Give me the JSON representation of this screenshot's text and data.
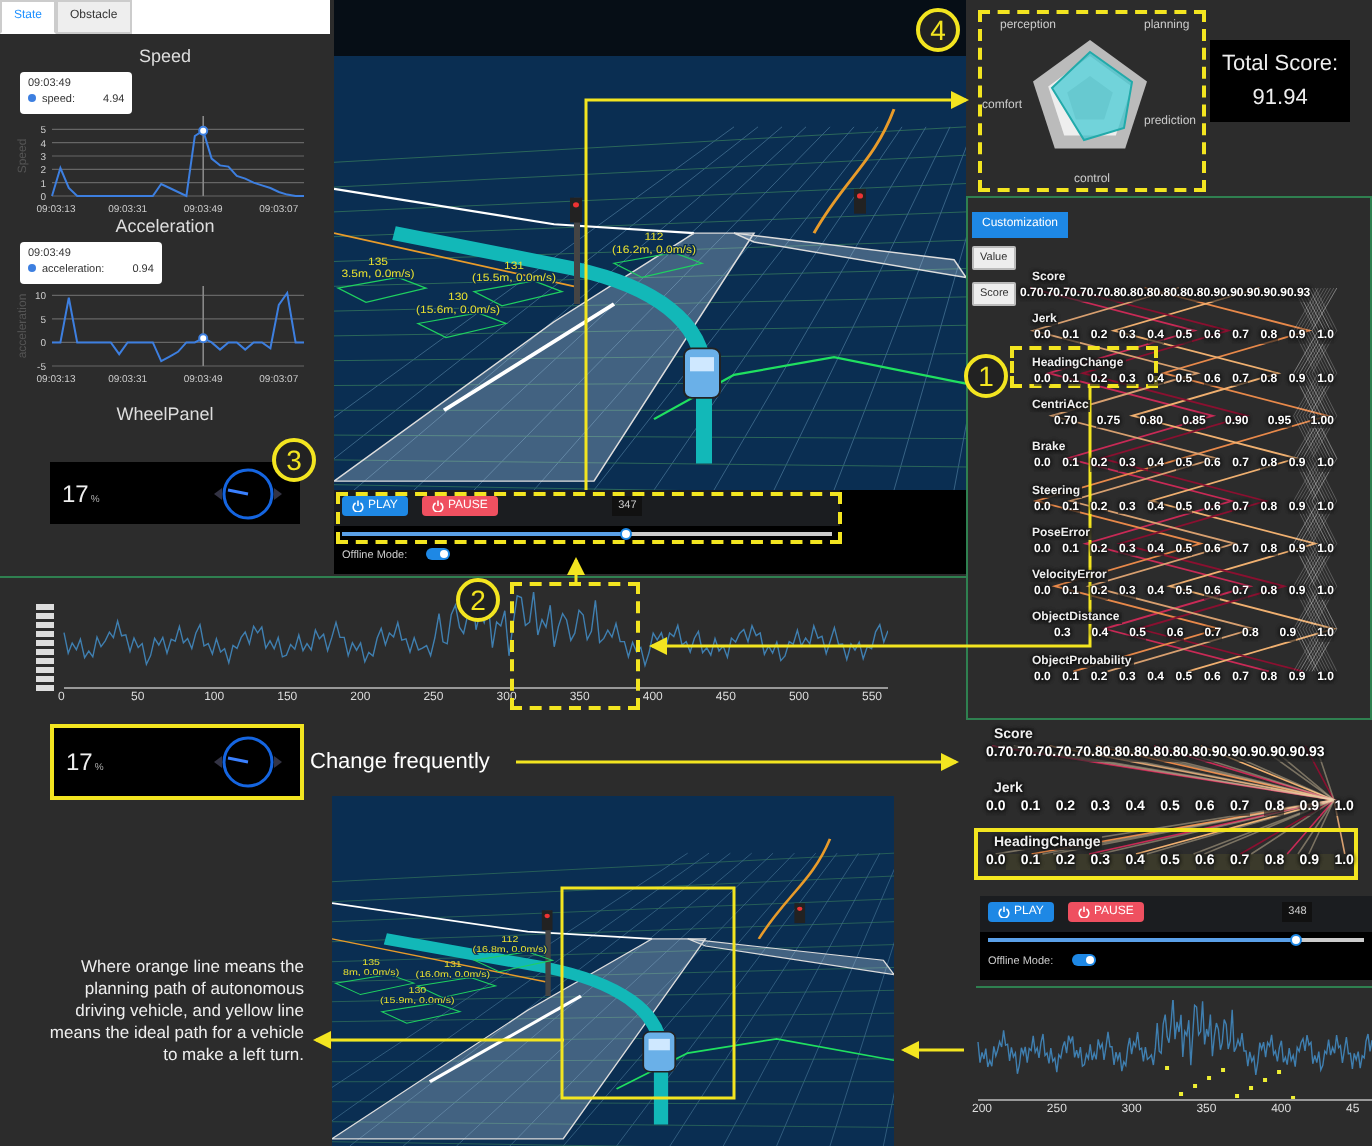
{
  "tabs": [
    {
      "label": "State",
      "selected": true
    },
    {
      "label": "Obstacle",
      "selected": false
    }
  ],
  "speed_chart": {
    "title": "Speed",
    "tooltip": {
      "time": "09:03:49",
      "series": "speed:",
      "value": "4.94"
    },
    "chart_data": {
      "type": "line",
      "ylabel": "Speed",
      "categories": [
        "09:03:13",
        null,
        null,
        null,
        null,
        null,
        null,
        null,
        null,
        "09:03:31",
        null,
        null,
        null,
        null,
        null,
        null,
        null,
        null,
        "09:03:49",
        null,
        null,
        null,
        null,
        null,
        null,
        null,
        null,
        "09:03:07",
        null,
        null,
        null
      ],
      "series": [
        {
          "color": "#3d7fe0",
          "values": [
            0,
            2.1,
            0.6,
            0,
            0,
            0,
            0,
            0,
            0,
            0,
            0,
            0,
            0,
            0.9,
            0.6,
            0.3,
            0,
            4.5,
            4.9,
            2.8,
            2.3,
            2.2,
            1.5,
            1.3,
            1.0,
            0.8,
            0.6,
            0.3,
            0.1,
            0,
            0
          ]
        }
      ],
      "yticks": [
        0,
        1,
        2,
        3,
        4,
        5
      ],
      "ylim": [
        0,
        6
      ],
      "grid": true
    }
  },
  "acceleration_chart": {
    "title": "Acceleration",
    "tooltip": {
      "time": "09:03:49",
      "series": "acceleration:",
      "value": "0.94"
    },
    "chart_data": {
      "type": "line",
      "ylabel": "acceleration",
      "categories": [
        "09:03:13",
        null,
        null,
        null,
        null,
        null,
        null,
        null,
        null,
        "09:03:31",
        null,
        null,
        null,
        null,
        null,
        null,
        null,
        null,
        "09:03:49",
        null,
        null,
        null,
        null,
        null,
        null,
        null,
        null,
        "09:03:07",
        null,
        null,
        null
      ],
      "series": [
        {
          "color": "#3d7fe0",
          "values": [
            0,
            0,
            9.5,
            0,
            0,
            0,
            0,
            0,
            -2.5,
            0,
            0,
            0,
            0,
            -4,
            -3,
            -2,
            0,
            0,
            0.9,
            0,
            -1.5,
            0,
            0,
            -1.5,
            0,
            0,
            -1.2,
            8,
            10.5,
            0,
            0
          ]
        }
      ],
      "yticks": [
        -5,
        0,
        5,
        10
      ],
      "ylim": [
        -5,
        12
      ],
      "grid": true
    }
  },
  "wheel_panel": {
    "title": "WheelPanel",
    "value": "17",
    "unit": "%"
  },
  "scene_view": {
    "obstacles": [
      {
        "id": "112",
        "label": "(16.2m, 0.0m/s)"
      },
      {
        "id": "135",
        "label": "3.5m, 0.0m/s)"
      },
      {
        "id": "131",
        "label": "(15.5m, 0.0m/s)"
      },
      {
        "id": "130",
        "label": "(15.6m, 0.0m/s)"
      }
    ]
  },
  "playback": {
    "play": "PLAY",
    "pause": "PAUSE",
    "frame": "347",
    "level": 0.58,
    "offline_label": "Offline Mode:",
    "offline_on": true
  },
  "radar": {
    "axes": [
      "perception",
      "planning",
      "prediction",
      "control",
      "comfort"
    ],
    "total_label": "Total Score:",
    "total": "91.94"
  },
  "evaluation_panel": {
    "customize_button": "Customization",
    "buttons": [
      "Value",
      "Score"
    ],
    "axes": [
      {
        "name": "Score",
        "ticks": [
          "0.70.70.70.70.70.80.80.80.80.80.80.90.90.90.90.90.93"
        ]
      },
      {
        "name": "Jerk",
        "ticks": [
          "0.0",
          "0.1",
          "0.2",
          "0.3",
          "0.4",
          "0.5",
          "0.6",
          "0.7",
          "0.8",
          "0.9",
          "1.0"
        ]
      },
      {
        "name": "HeadingChange",
        "ticks": [
          "0.0",
          "0.1",
          "0.2",
          "0.3",
          "0.4",
          "0.5",
          "0.6",
          "0.7",
          "0.8",
          "0.9",
          "1.0"
        ]
      },
      {
        "name": "CentriAcc",
        "ticks": [
          "0.70",
          "0.75",
          "0.80",
          "0.85",
          "0.90",
          "0.95",
          "1.00"
        ]
      },
      {
        "name": "Brake",
        "ticks": [
          "0.0",
          "0.1",
          "0.2",
          "0.3",
          "0.4",
          "0.5",
          "0.6",
          "0.7",
          "0.8",
          "0.9",
          "1.0"
        ]
      },
      {
        "name": "Steering",
        "ticks": [
          "0.0",
          "0.1",
          "0.2",
          "0.3",
          "0.4",
          "0.5",
          "0.6",
          "0.7",
          "0.8",
          "0.9",
          "1.0"
        ]
      },
      {
        "name": "PoseError",
        "ticks": [
          "0.0",
          "0.1",
          "0.2",
          "0.3",
          "0.4",
          "0.5",
          "0.6",
          "0.7",
          "0.8",
          "0.9",
          "1.0"
        ]
      },
      {
        "name": "VelocityError",
        "ticks": [
          "0.0",
          "0.1",
          "0.2",
          "0.3",
          "0.4",
          "0.5",
          "0.6",
          "0.7",
          "0.8",
          "0.9",
          "1.0"
        ]
      },
      {
        "name": "ObjectDistance",
        "ticks": [
          "0.3",
          "0.4",
          "0.5",
          "0.6",
          "0.7",
          "0.8",
          "0.9",
          "1.0"
        ]
      },
      {
        "name": "ObjectProbability",
        "ticks": [
          "0.0",
          "0.1",
          "0.2",
          "0.3",
          "0.4",
          "0.5",
          "0.6",
          "0.7",
          "0.8",
          "0.9",
          "1.0"
        ]
      }
    ]
  },
  "timeline_chart": {
    "xticks": [
      "0",
      "50",
      "100",
      "150",
      "200",
      "250",
      "300",
      "350",
      "400",
      "450",
      "500",
      "550"
    ]
  },
  "callouts": [
    "1",
    "2",
    "3",
    "4"
  ],
  "zoom_wheel": {
    "value": "17",
    "unit": "%"
  },
  "change_note": "Change frequently",
  "explanation": "Where orange line means the planning path of autonomous driving vehicle, and yellow line means the ideal path for a vehicle to make a left turn.",
  "zoom_scene": {
    "obstacles": [
      {
        "id": "112",
        "label": "(16.8m, 0.0m/s)"
      },
      {
        "id": "135",
        "label": "8m, 0.0m/s)"
      },
      {
        "id": "131",
        "label": "(16.0m, 0.0m/s)"
      },
      {
        "id": "130",
        "label": "(15.9m, 0.0m/s)"
      }
    ]
  },
  "zoom_axes": [
    {
      "name": "Score",
      "ticks": [
        "0.70.70.70.70.70.80.80.80.80.80.80.90.90.90.90.90.93"
      ],
      "highlighted": false
    },
    {
      "name": "Jerk",
      "ticks": [
        "0.0",
        "0.1",
        "0.2",
        "0.3",
        "0.4",
        "0.5",
        "0.6",
        "0.7",
        "0.8",
        "0.9",
        "1.0"
      ],
      "highlighted": false
    },
    {
      "name": "HeadingChange",
      "ticks": [
        "0.0",
        "0.1",
        "0.2",
        "0.3",
        "0.4",
        "0.5",
        "0.6",
        "0.7",
        "0.8",
        "0.9",
        "1.0"
      ],
      "highlighted": true
    }
  ],
  "zoom_playback": {
    "play": "PLAY",
    "pause": "PAUSE",
    "frame": "348",
    "level": 0.82,
    "offline_label": "Offline Mode:",
    "offline_on": true
  },
  "zoom_timeline": {
    "xticks": [
      "200",
      "250",
      "300",
      "350",
      "400",
      "45"
    ]
  }
}
